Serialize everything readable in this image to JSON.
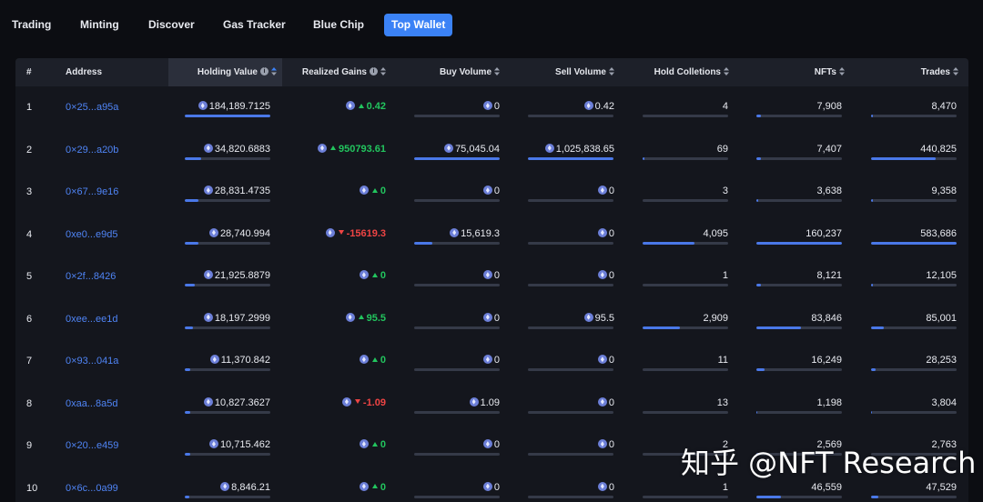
{
  "nav": {
    "items": [
      "Trading",
      "Minting",
      "Discover",
      "Gas Tracker",
      "Blue Chip",
      "Top Wallet"
    ],
    "active_index": 5
  },
  "table": {
    "columns": [
      "#",
      "Address",
      "Holding Value",
      "Realized Gains",
      "Buy Volume",
      "Sell Volume",
      "Hold Colletions",
      "NFTs",
      "Trades"
    ],
    "sorted_column": "Holding Value",
    "rows": [
      {
        "rank": "1",
        "address": "0×25...a95a",
        "holding": "184,189.7125",
        "holding_fill": 1.0,
        "gain": "0.42",
        "gain_dir": "up",
        "buy": "0",
        "buy_fill": 0.0,
        "sell": "0.42",
        "sell_fill": 0.0,
        "hold": "4",
        "hold_fill": 0.0,
        "nfts": "7,908",
        "nfts_fill": 0.05,
        "trades": "8,470",
        "trades_fill": 0.02
      },
      {
        "rank": "2",
        "address": "0×29...a20b",
        "holding": "34,820.6883",
        "holding_fill": 0.19,
        "gain": "950793.61",
        "gain_dir": "up",
        "buy": "75,045.04",
        "buy_fill": 1.0,
        "sell": "1,025,838.65",
        "sell_fill": 1.0,
        "hold": "69",
        "hold_fill": 0.02,
        "nfts": "7,407",
        "nfts_fill": 0.05,
        "trades": "440,825",
        "trades_fill": 0.76
      },
      {
        "rank": "3",
        "address": "0×67...9e16",
        "holding": "28,831.4735",
        "holding_fill": 0.16,
        "gain": "0",
        "gain_dir": "up",
        "buy": "0",
        "buy_fill": 0.0,
        "sell": "0",
        "sell_fill": 0.0,
        "hold": "3",
        "hold_fill": 0.0,
        "nfts": "3,638",
        "nfts_fill": 0.02,
        "trades": "9,358",
        "trades_fill": 0.02
      },
      {
        "rank": "4",
        "address": "0xe0...e9d5",
        "holding": "28,740.994",
        "holding_fill": 0.16,
        "gain": "-15619.3",
        "gain_dir": "down",
        "buy": "15,619.3",
        "buy_fill": 0.21,
        "sell": "0",
        "sell_fill": 0.0,
        "hold": "4,095",
        "hold_fill": 0.61,
        "nfts": "160,237",
        "nfts_fill": 1.0,
        "trades": "583,686",
        "trades_fill": 1.0
      },
      {
        "rank": "5",
        "address": "0×2f...8426",
        "holding": "21,925.8879",
        "holding_fill": 0.12,
        "gain": "0",
        "gain_dir": "up",
        "buy": "0",
        "buy_fill": 0.0,
        "sell": "0",
        "sell_fill": 0.0,
        "hold": "1",
        "hold_fill": 0.0,
        "nfts": "8,121",
        "nfts_fill": 0.05,
        "trades": "12,105",
        "trades_fill": 0.02
      },
      {
        "rank": "6",
        "address": "0xee...ee1d",
        "holding": "18,197.2999",
        "holding_fill": 0.1,
        "gain": "95.5",
        "gain_dir": "up",
        "buy": "0",
        "buy_fill": 0.0,
        "sell": "95.5",
        "sell_fill": 0.0,
        "hold": "2,909",
        "hold_fill": 0.44,
        "nfts": "83,846",
        "nfts_fill": 0.52,
        "trades": "85,001",
        "trades_fill": 0.15
      },
      {
        "rank": "7",
        "address": "0×93...041a",
        "holding": "11,370.842",
        "holding_fill": 0.06,
        "gain": "0",
        "gain_dir": "up",
        "buy": "0",
        "buy_fill": 0.0,
        "sell": "0",
        "sell_fill": 0.0,
        "hold": "11",
        "hold_fill": 0.0,
        "nfts": "16,249",
        "nfts_fill": 0.1,
        "trades": "28,253",
        "trades_fill": 0.05
      },
      {
        "rank": "8",
        "address": "0xaa...8a5d",
        "holding": "10,827.3627",
        "holding_fill": 0.06,
        "gain": "-1.09",
        "gain_dir": "down",
        "buy": "1.09",
        "buy_fill": 0.0,
        "sell": "0",
        "sell_fill": 0.0,
        "hold": "13",
        "hold_fill": 0.0,
        "nfts": "1,198",
        "nfts_fill": 0.01,
        "trades": "3,804",
        "trades_fill": 0.01
      },
      {
        "rank": "9",
        "address": "0×20...e459",
        "holding": "10,715.462",
        "holding_fill": 0.06,
        "gain": "0",
        "gain_dir": "up",
        "buy": "0",
        "buy_fill": 0.0,
        "sell": "0",
        "sell_fill": 0.0,
        "hold": "2",
        "hold_fill": 0.0,
        "nfts": "2,569",
        "nfts_fill": 0.02,
        "trades": "2,763",
        "trades_fill": 0.0
      },
      {
        "rank": "10",
        "address": "0×6c...0a99",
        "holding": "8,846.21",
        "holding_fill": 0.05,
        "gain": "0",
        "gain_dir": "up",
        "buy": "0",
        "buy_fill": 0.0,
        "sell": "0",
        "sell_fill": 0.0,
        "hold": "1",
        "hold_fill": 0.0,
        "nfts": "46,559",
        "nfts_fill": 0.29,
        "trades": "47,529",
        "trades_fill": 0.08
      }
    ]
  },
  "watermark": "知乎 @NFT Research",
  "colors": {
    "accent": "#3b82f6",
    "gain": "#22c55e",
    "loss": "#ef4444",
    "link": "#4f84f5"
  }
}
